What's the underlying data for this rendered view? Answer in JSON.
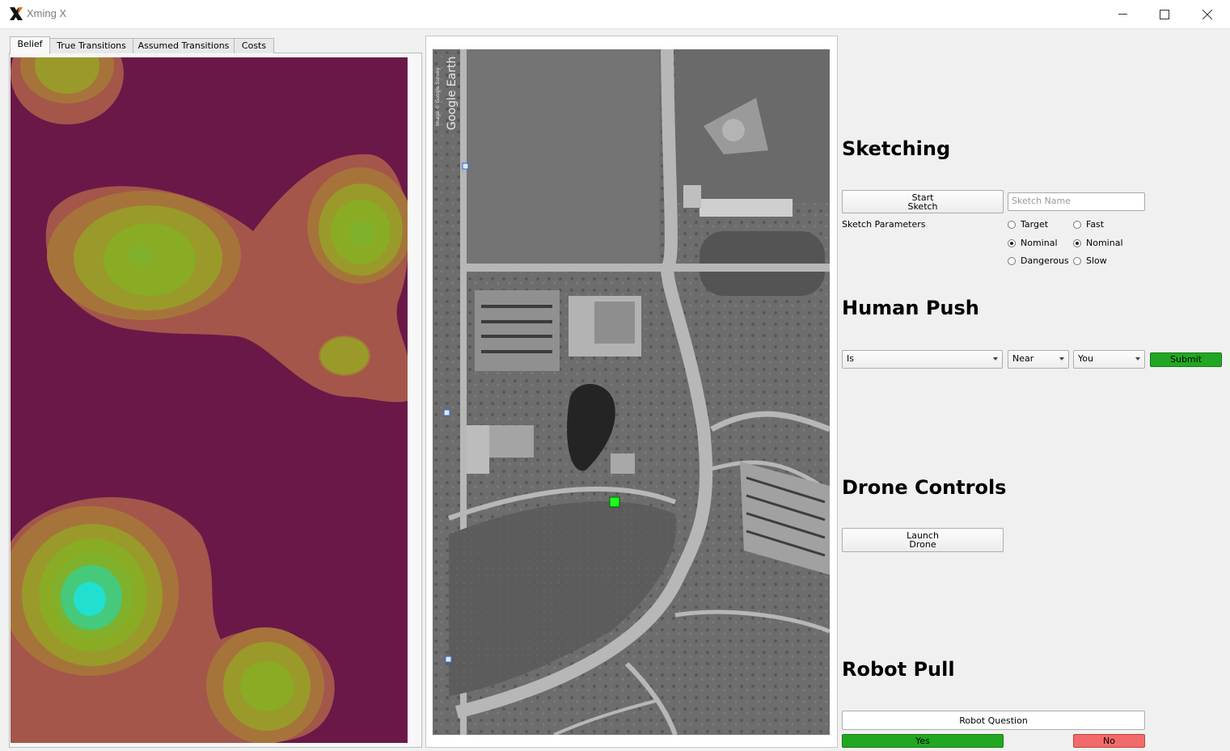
{
  "window": {
    "title": "Xming X",
    "logo_icon": "xming-x-icon",
    "controls": [
      "minimize-icon",
      "maximize-icon",
      "close-icon"
    ]
  },
  "tabs": [
    {
      "label": "Belief",
      "active": true
    },
    {
      "label": "True Transitions",
      "active": false
    },
    {
      "label": "Assumed Transitions",
      "active": false
    },
    {
      "label": "Costs",
      "active": false
    }
  ],
  "belief_map": {
    "colors": {
      "background": "#6a1848",
      "level1": "#a4564a",
      "level2": "#a6743a",
      "level3": "#999a2a",
      "level4": "#8aab24",
      "level5": "#6fbc3d",
      "level6": "#45c97b",
      "level7": "#22e0d0"
    }
  },
  "map": {
    "watermark": "Google Earth",
    "sub_watermark": "Image © Google Survey",
    "drone_marker_color": "#19ff19"
  },
  "sketching": {
    "title": "Sketching",
    "start_button": "Start\nSketch",
    "name_placeholder": "Sketch Name",
    "params_label": "Sketch Parameters",
    "col1": [
      {
        "label": "Target",
        "checked": false
      },
      {
        "label": "Nominal",
        "checked": true
      },
      {
        "label": "Dangerous",
        "checked": false
      }
    ],
    "col2": [
      {
        "label": "Fast",
        "checked": false
      },
      {
        "label": "Nominal",
        "checked": true
      },
      {
        "label": "Slow",
        "checked": false
      }
    ]
  },
  "human_push": {
    "title": "Human Push",
    "verb": "Is",
    "relation": "Near",
    "object": "You",
    "submit": "Submit"
  },
  "drone": {
    "title": "Drone Controls",
    "launch": "Launch\nDrone"
  },
  "robot_pull": {
    "title": "Robot Pull",
    "question": "Robot Question",
    "yes": "Yes",
    "no": "No"
  }
}
